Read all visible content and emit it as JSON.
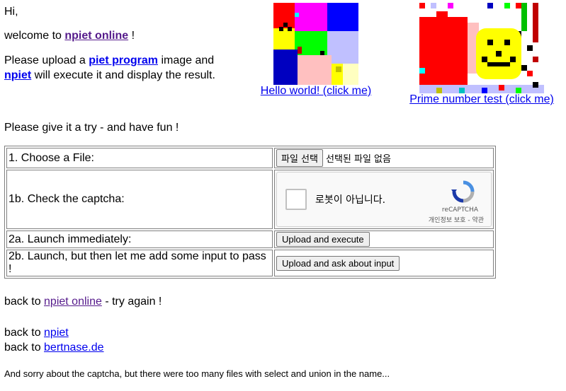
{
  "intro": {
    "greeting": "Hi,",
    "welcome_pre": "welcome to ",
    "welcome_link": "npiet online",
    "welcome_post": " !",
    "upload_pre": "Please upload a ",
    "upload_link": "piet program",
    "upload_post": " image and",
    "npiet_link": "npiet",
    "execute_post": " will execute it and display the result."
  },
  "samples": [
    {
      "label": "Hello world! (click me)"
    },
    {
      "label": "Prime number test (click me)"
    }
  ],
  "try_text": "Please give it a try - and have fun !",
  "form": {
    "rows": [
      {
        "label": "1. Choose a File:"
      },
      {
        "label": "1b. Check the captcha:"
      },
      {
        "label": "2a. Launch immediately:"
      },
      {
        "label": "2b. Launch, but then let me add some input to pass !"
      }
    ],
    "file_button": "파일 선택",
    "file_status": "선택된 파일 없음",
    "captcha": {
      "label": "로봇이 아닙니다.",
      "brand": "reCAPTCHA",
      "privacy": "개인정보 보호",
      "separator": " - ",
      "terms": "약관"
    },
    "execute_button": "Upload and execute",
    "ask_button": "Upload and ask about input"
  },
  "back": {
    "back_pre": "back to ",
    "online_link": "npiet online",
    "online_post": " - try again !",
    "npiet_link": "npiet",
    "bertnase_link": "bertnase.de"
  },
  "sorry": "And sorry about the captcha, but there were too many files with select and union in the name..."
}
